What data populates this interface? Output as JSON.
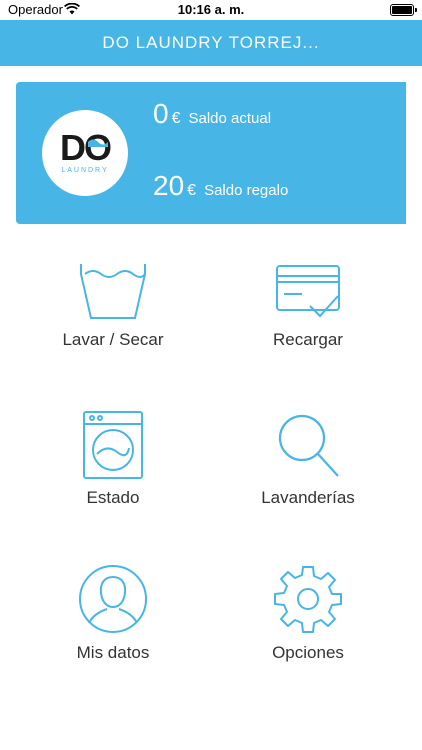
{
  "status_bar": {
    "carrier": "Operador",
    "time": "10:16 a. m."
  },
  "header": {
    "title": "DO LAUNDRY TORREJ..."
  },
  "card": {
    "logo_text": "DO",
    "logo_sub": "LAUNDRY",
    "balance": {
      "amount": "0",
      "currency": "€",
      "label": "Saldo actual"
    },
    "gift": {
      "amount": "20",
      "currency": "€",
      "label": "Saldo regalo"
    }
  },
  "menu": [
    {
      "label": "Lavar / Secar",
      "icon": "wash-basin-icon"
    },
    {
      "label": "Recargar",
      "icon": "credit-card-icon"
    },
    {
      "label": "Estado",
      "icon": "washing-machine-icon"
    },
    {
      "label": "Lavanderías",
      "icon": "search-icon"
    },
    {
      "label": "Mis datos",
      "icon": "user-icon"
    },
    {
      "label": "Opciones",
      "icon": "gear-icon"
    }
  ],
  "colors": {
    "accent": "#47b5e6",
    "text": "#333333",
    "background": "#ffffff"
  }
}
